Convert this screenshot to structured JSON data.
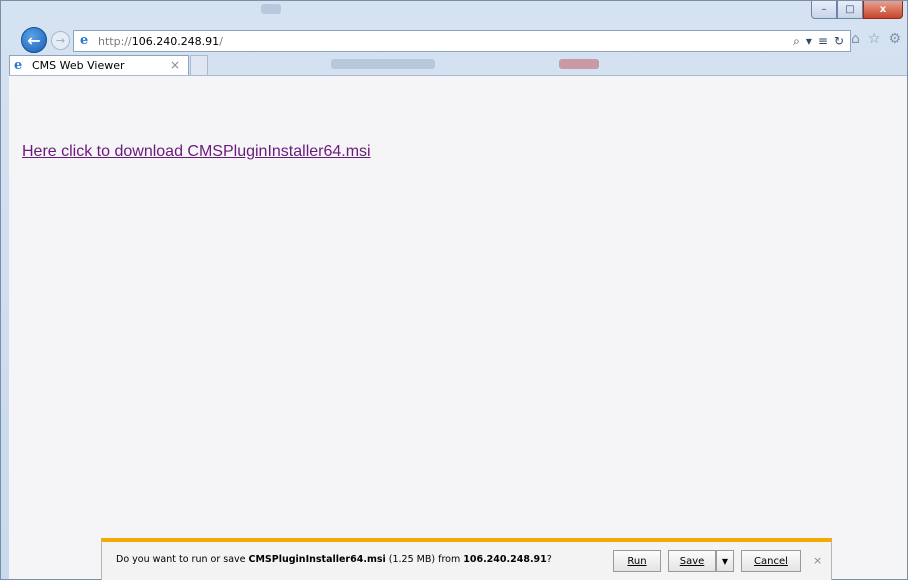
{
  "window": {
    "controls": {
      "minimize": "–",
      "maximize": "□",
      "close": "x"
    }
  },
  "address_bar": {
    "url_protocol": "http://",
    "url_host": "106.240.248.91",
    "url_tail": "/",
    "back_icon": "back-arrow-icon",
    "forward_icon": "forward-arrow-icon",
    "actions": [
      "search-icon",
      "dropdown-icon",
      "compat-view-icon",
      "refresh-icon"
    ],
    "action_glyphs": [
      "⌕",
      "▾",
      "≡",
      "↻"
    ],
    "tools": [
      "home-icon",
      "favorites-icon",
      "settings-gear-icon"
    ],
    "tool_glyphs": [
      "⌂",
      "☆",
      "⚙"
    ]
  },
  "tabs": [
    {
      "label": "CMS Web Viewer",
      "active": true,
      "close": "×"
    }
  ],
  "content": {
    "download_link": "Here click to download CMSPluginInstaller64.msi"
  },
  "notification": {
    "prefix": "Do you want to run or save ",
    "filename": "CMSPluginInstaller64.msi",
    "size": " (1.25 MB) from ",
    "host": "106.240.248.91",
    "suffix": "?",
    "run_label": "Run",
    "save_label": "Save",
    "cancel_label": "Cancel",
    "close": "×"
  },
  "colors": {
    "link": "#6a1b7a",
    "notification_accent": "#f2a900",
    "window_frame": "#d5e2f1"
  }
}
